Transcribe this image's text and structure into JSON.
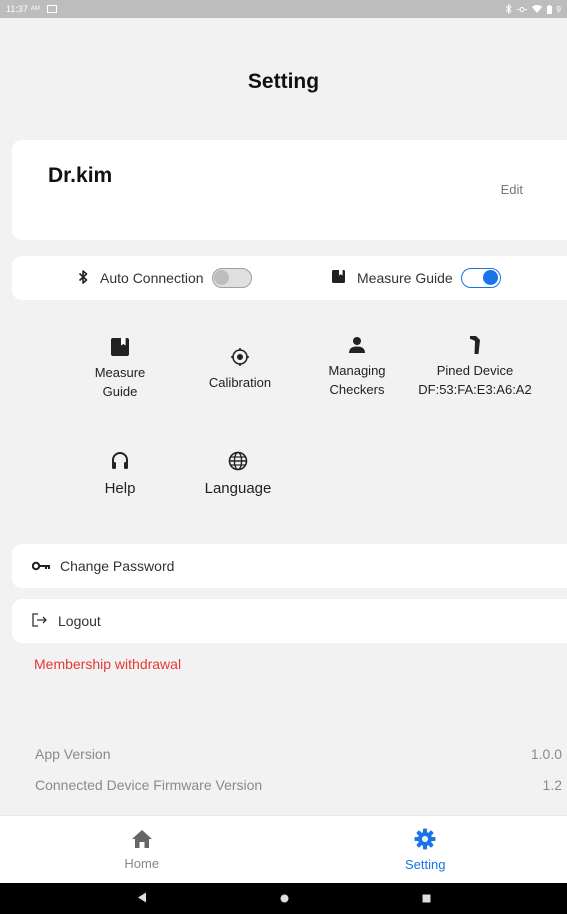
{
  "status_bar": {
    "time": "11:37",
    "ampm": "AM"
  },
  "header": {
    "title": "Setting"
  },
  "profile": {
    "name": "Dr.kim",
    "edit_label": "Edit"
  },
  "toggles": {
    "auto_connection": {
      "label": "Auto Connection",
      "on": false
    },
    "measure_guide": {
      "label": "Measure Guide",
      "on": true
    }
  },
  "menu": {
    "measure_guide": "Measure\nGuide",
    "calibration": "Calibration",
    "managing_checkers": "Managing\nCheckers",
    "pined_device": "Pined Device",
    "pined_device_mac": "DF:53:FA:E3:A6:A2",
    "help": "Help",
    "language": "Language"
  },
  "account": {
    "change_password": "Change Password",
    "logout": "Logout",
    "withdrawal": "Membership withdrawal"
  },
  "info": {
    "app_version_label": "App Version",
    "app_version": "1.0.0",
    "firmware_label": "Connected Device Firmware Version",
    "firmware_version": "1.2"
  },
  "bottom_nav": {
    "home": "Home",
    "setting": "Setting",
    "active": "setting"
  },
  "colors": {
    "accent": "#1a73e8",
    "danger": "#e53935",
    "background": "#f2f2f2"
  }
}
